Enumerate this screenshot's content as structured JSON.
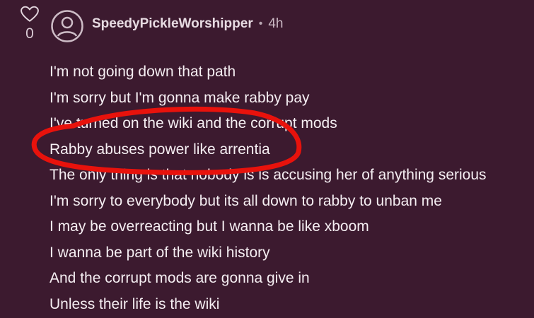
{
  "comment": {
    "author": "SpeedyPickleWorshipper",
    "separator": "•",
    "timestamp": "4h",
    "vote_count": "0",
    "body_lines": [
      "I'm not going down that path",
      "I'm sorry but I'm gonna make rabby pay",
      "I've turned on the wiki and the corrupt mods",
      "Rabby abuses power like arrentia",
      "The only thing is that nobody is is accusing her of anything serious",
      "I'm sorry to everybody but its all down to rabby to unban me",
      "I may be overreacting but I wanna be like xboom",
      "I wanna be part of the wiki history",
      "And the corrupt mods are gonna give in",
      "Unless their life is the wiki"
    ]
  },
  "icons": {
    "vote": "heart-icon",
    "avatar": "user-avatar-icon"
  },
  "colors": {
    "background": "#3c1a2f",
    "annotation": "#e8120c"
  }
}
